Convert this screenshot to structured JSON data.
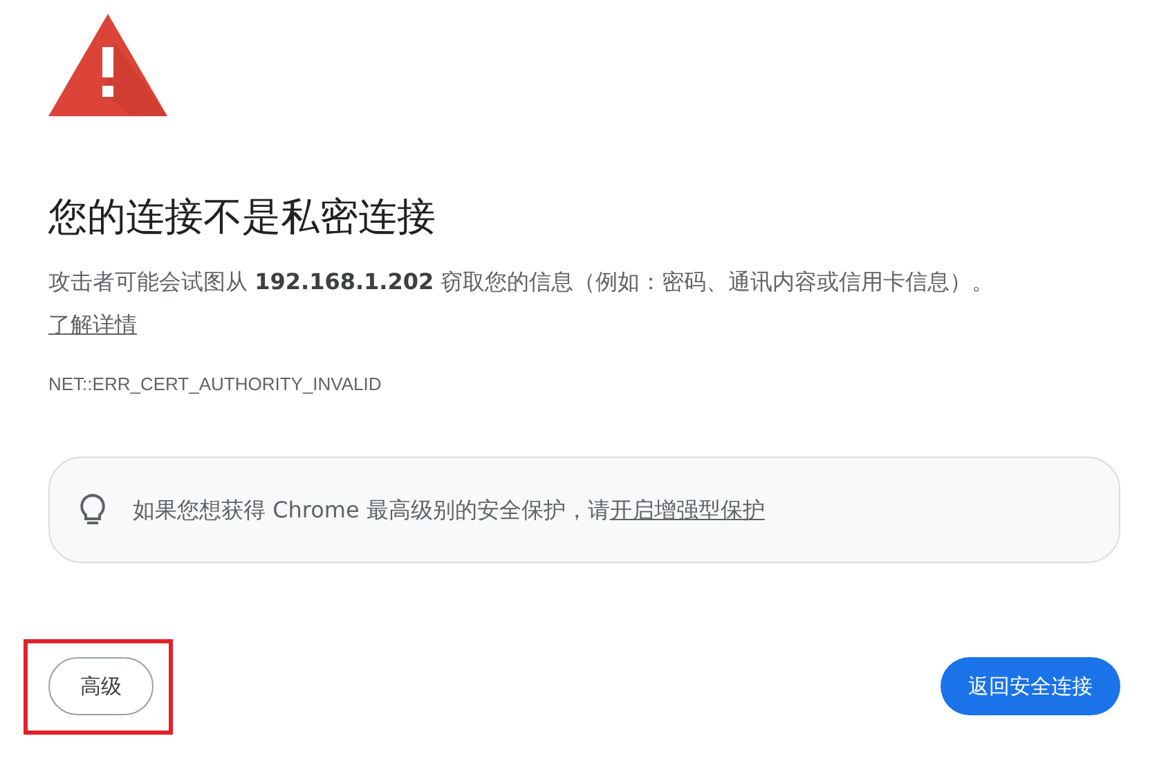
{
  "heading": "您的连接不是私密连接",
  "message": {
    "text": "攻击者可能会试图从 **192.168.1.202** 窃取您的信息（例如：密码、通讯内容或信用卡信息）。",
    "link": "了解详情"
  },
  "error_code": "NET::ERR_CERT_AUTHORITY_INVALID",
  "tip": {
    "text": "如果您想获得 Chrome 最高级别的安全保护，请",
    "link": "开启增强型保护"
  },
  "advanced_button": {
    "label": "高级",
    "highlighted": true
  },
  "back_button": {
    "label": "返回安全连接"
  }
}
